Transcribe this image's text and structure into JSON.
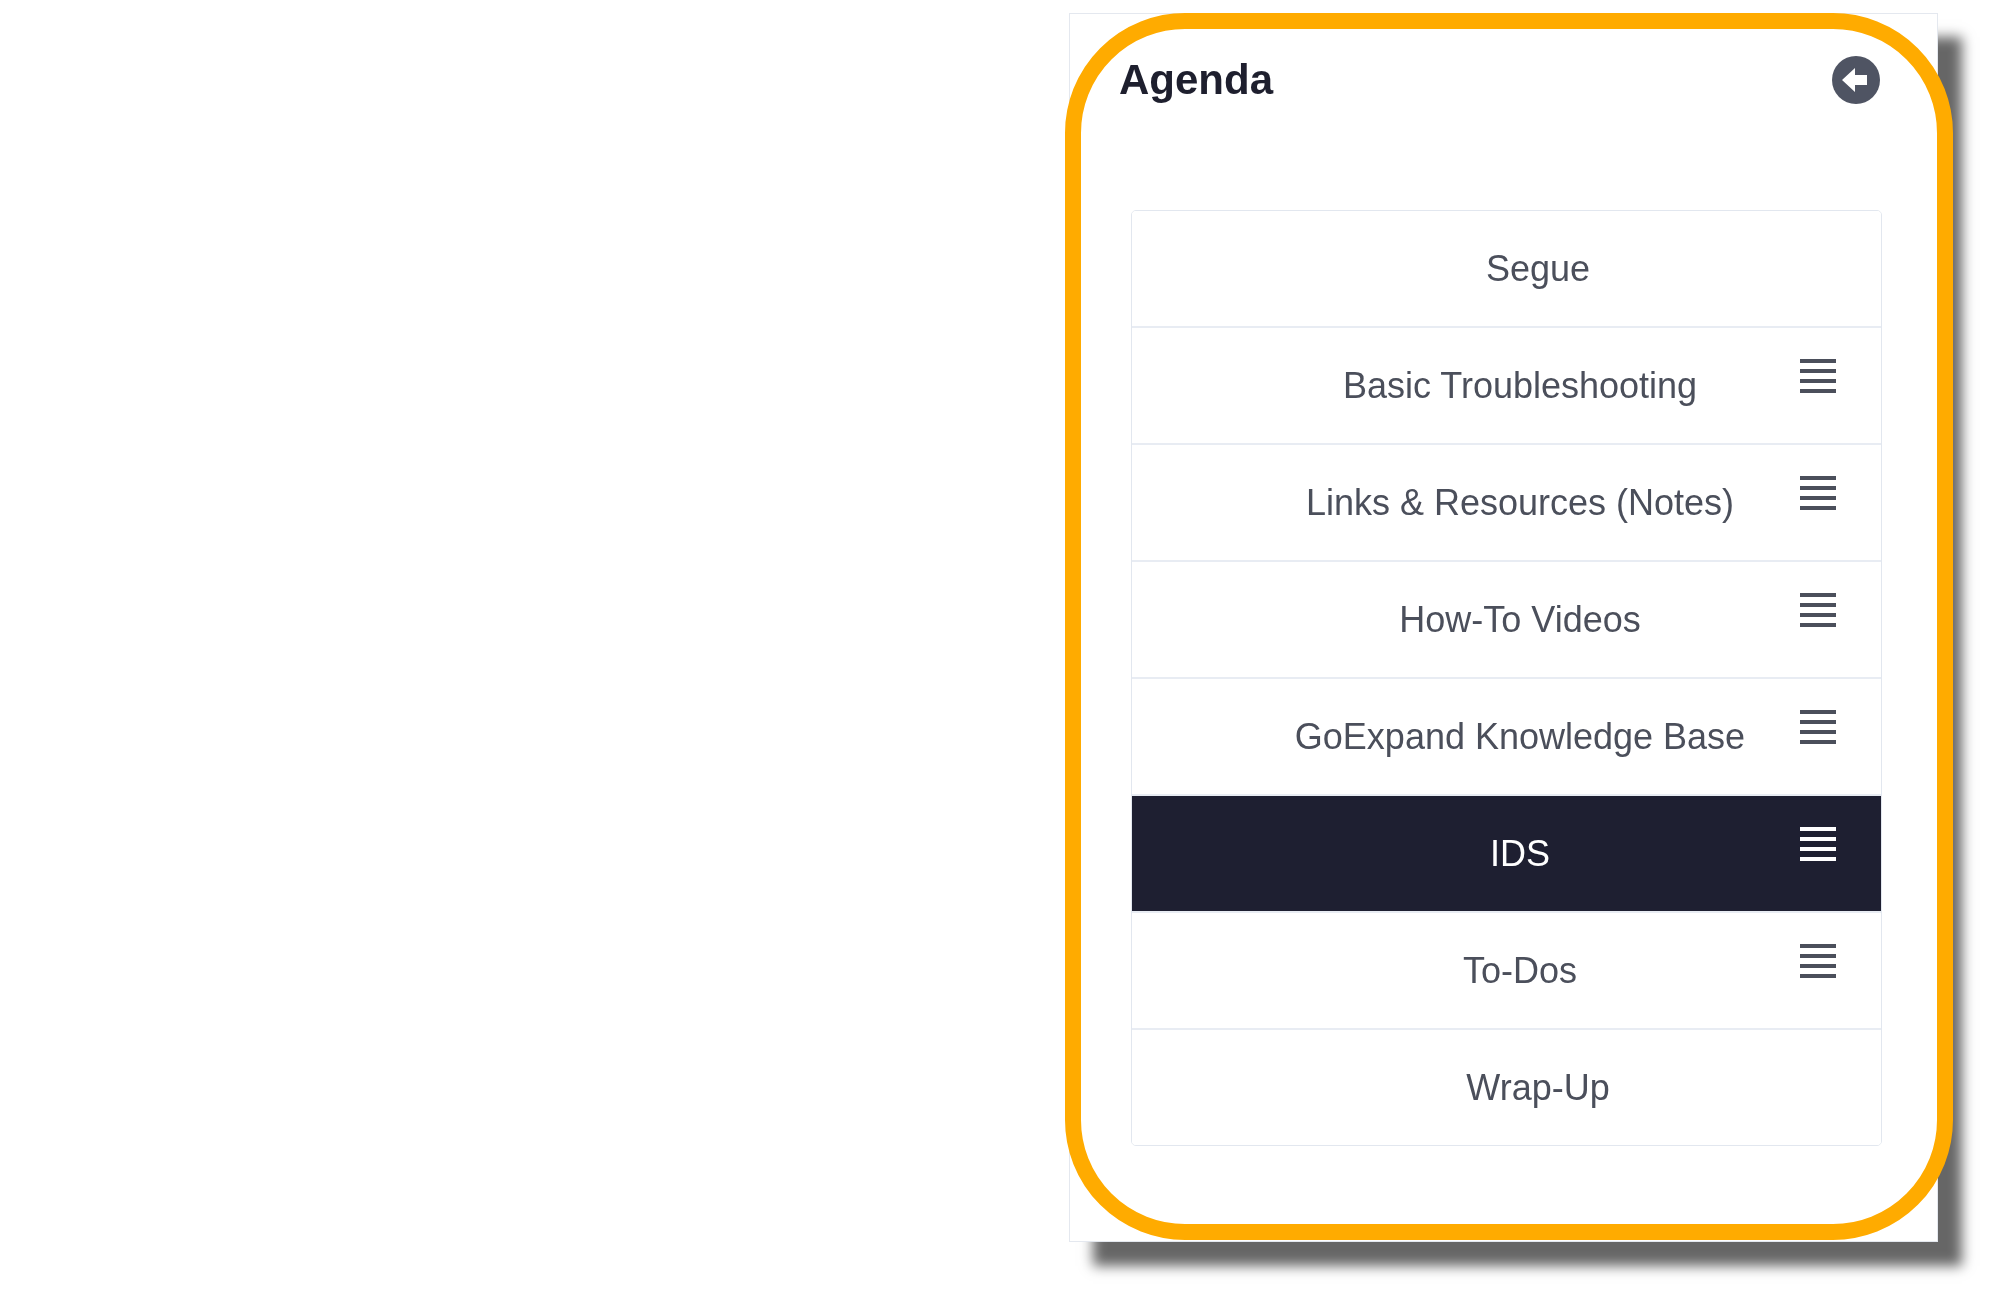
{
  "agenda": {
    "title": "Agenda",
    "items": [
      {
        "label": "Segue",
        "kind": "static",
        "selected": false
      },
      {
        "label": "Basic Troubleshooting",
        "kind": "movable",
        "selected": false
      },
      {
        "label": "Links & Resources (Notes)",
        "kind": "movable",
        "selected": false
      },
      {
        "label": "How-To Videos",
        "kind": "movable",
        "selected": false
      },
      {
        "label": "GoExpand Knowledge Base",
        "kind": "movable",
        "selected": false
      },
      {
        "label": "IDS",
        "kind": "movable",
        "selected": true
      },
      {
        "label": "To-Dos",
        "kind": "movable",
        "selected": false
      },
      {
        "label": "Wrap-Up",
        "kind": "static",
        "selected": false
      }
    ]
  }
}
